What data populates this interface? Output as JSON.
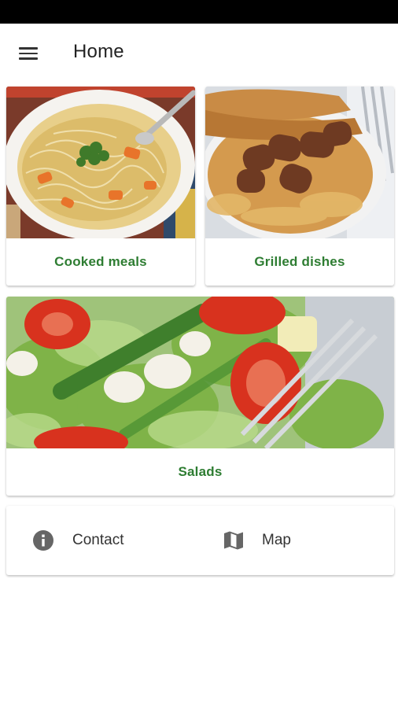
{
  "app_bar": {
    "title": "Home",
    "menu_icon": "menu-icon"
  },
  "colors": {
    "accent_text": "#2e7d32",
    "status_bar": "#000000",
    "icon_gray": "#666666"
  },
  "categories": [
    {
      "label": "Cooked meals",
      "image": "soup-photo"
    },
    {
      "label": "Grilled dishes",
      "image": "grilled-sausages-flatbread-photo"
    },
    {
      "label": "Salads",
      "image": "salad-photo"
    }
  ],
  "actions": [
    {
      "label": "Contact",
      "icon": "info-icon"
    },
    {
      "label": "Map",
      "icon": "map-icon"
    }
  ]
}
